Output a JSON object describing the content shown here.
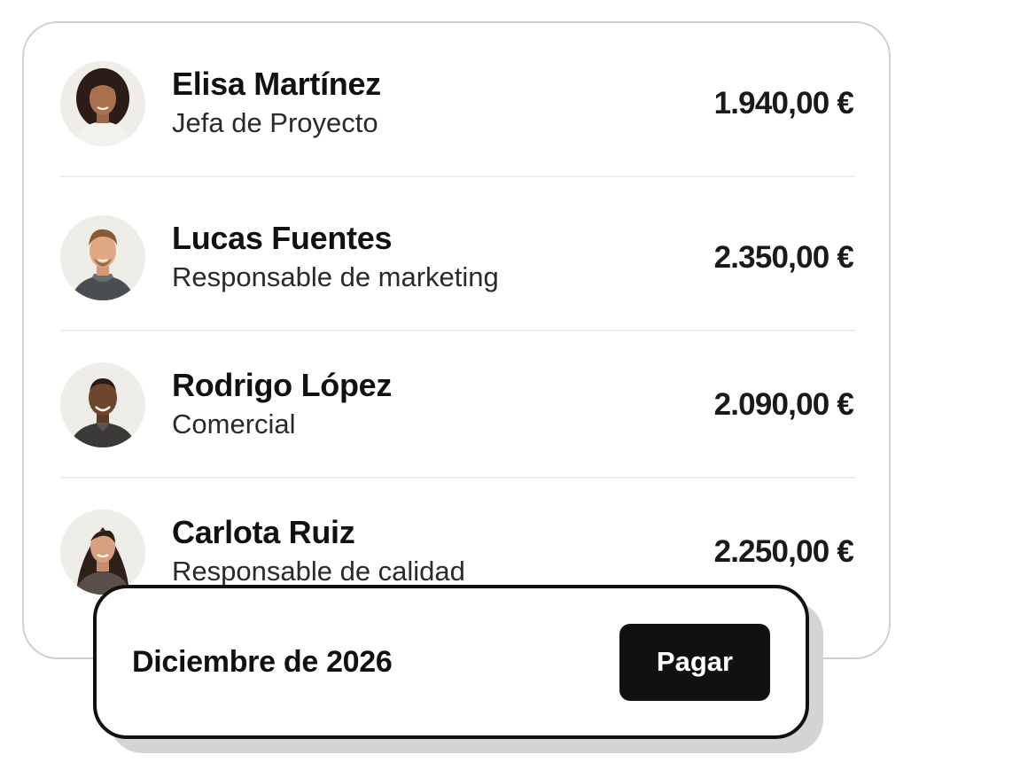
{
  "payroll": {
    "employees": [
      {
        "name": "Elisa Martínez",
        "role": "Jefa de Proyecto",
        "amount": "1.940,00 €",
        "avatar_icon": "female-portrait-icon"
      },
      {
        "name": "Lucas Fuentes",
        "role": "Responsable de marketing",
        "amount": "2.350,00 €",
        "avatar_icon": "male-portrait-icon"
      },
      {
        "name": "Rodrigo López",
        "role": "Comercial",
        "amount": "2.090,00 €",
        "avatar_icon": "male-portrait-icon"
      },
      {
        "name": "Carlota Ruiz",
        "role": "Responsable de calidad",
        "amount": "2.250,00 €",
        "avatar_icon": "female-portrait-icon"
      }
    ]
  },
  "pay_bar": {
    "period": "Diciembre de 2026",
    "pay_label": "Pagar"
  },
  "colors": {
    "accent": "#111111",
    "divider": "#ececec",
    "card_border": "#cfcfcf"
  }
}
